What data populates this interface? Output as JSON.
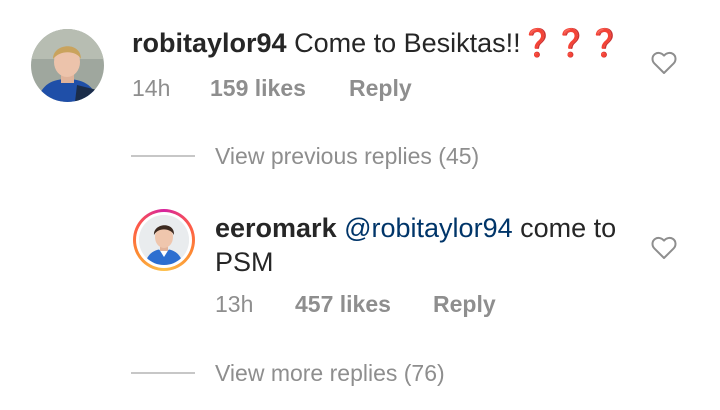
{
  "comments": [
    {
      "username": "robitaylor94",
      "text": "Come to Besiktas!!❓❓❓",
      "time": "14h",
      "likes": "159 likes",
      "reply_label": "Reply",
      "avatar": "robitaylor94-avatar",
      "like_icon": "heart-icon"
    },
    {
      "username": "eeromark",
      "mention": "@robitaylor94",
      "text_line1_rest": " come to",
      "text_line2": "PSM",
      "time": "13h",
      "likes": "457 likes",
      "reply_label": "Reply",
      "avatar": "eeromark-avatar",
      "like_icon": "heart-icon"
    }
  ],
  "view_previous_replies": "View previous replies (45)",
  "view_more_replies": "View more replies (76)",
  "colors": {
    "text": "#262626",
    "secondary": "#8e8e8e",
    "mention": "#003569",
    "divider": "#c7c7c7"
  }
}
